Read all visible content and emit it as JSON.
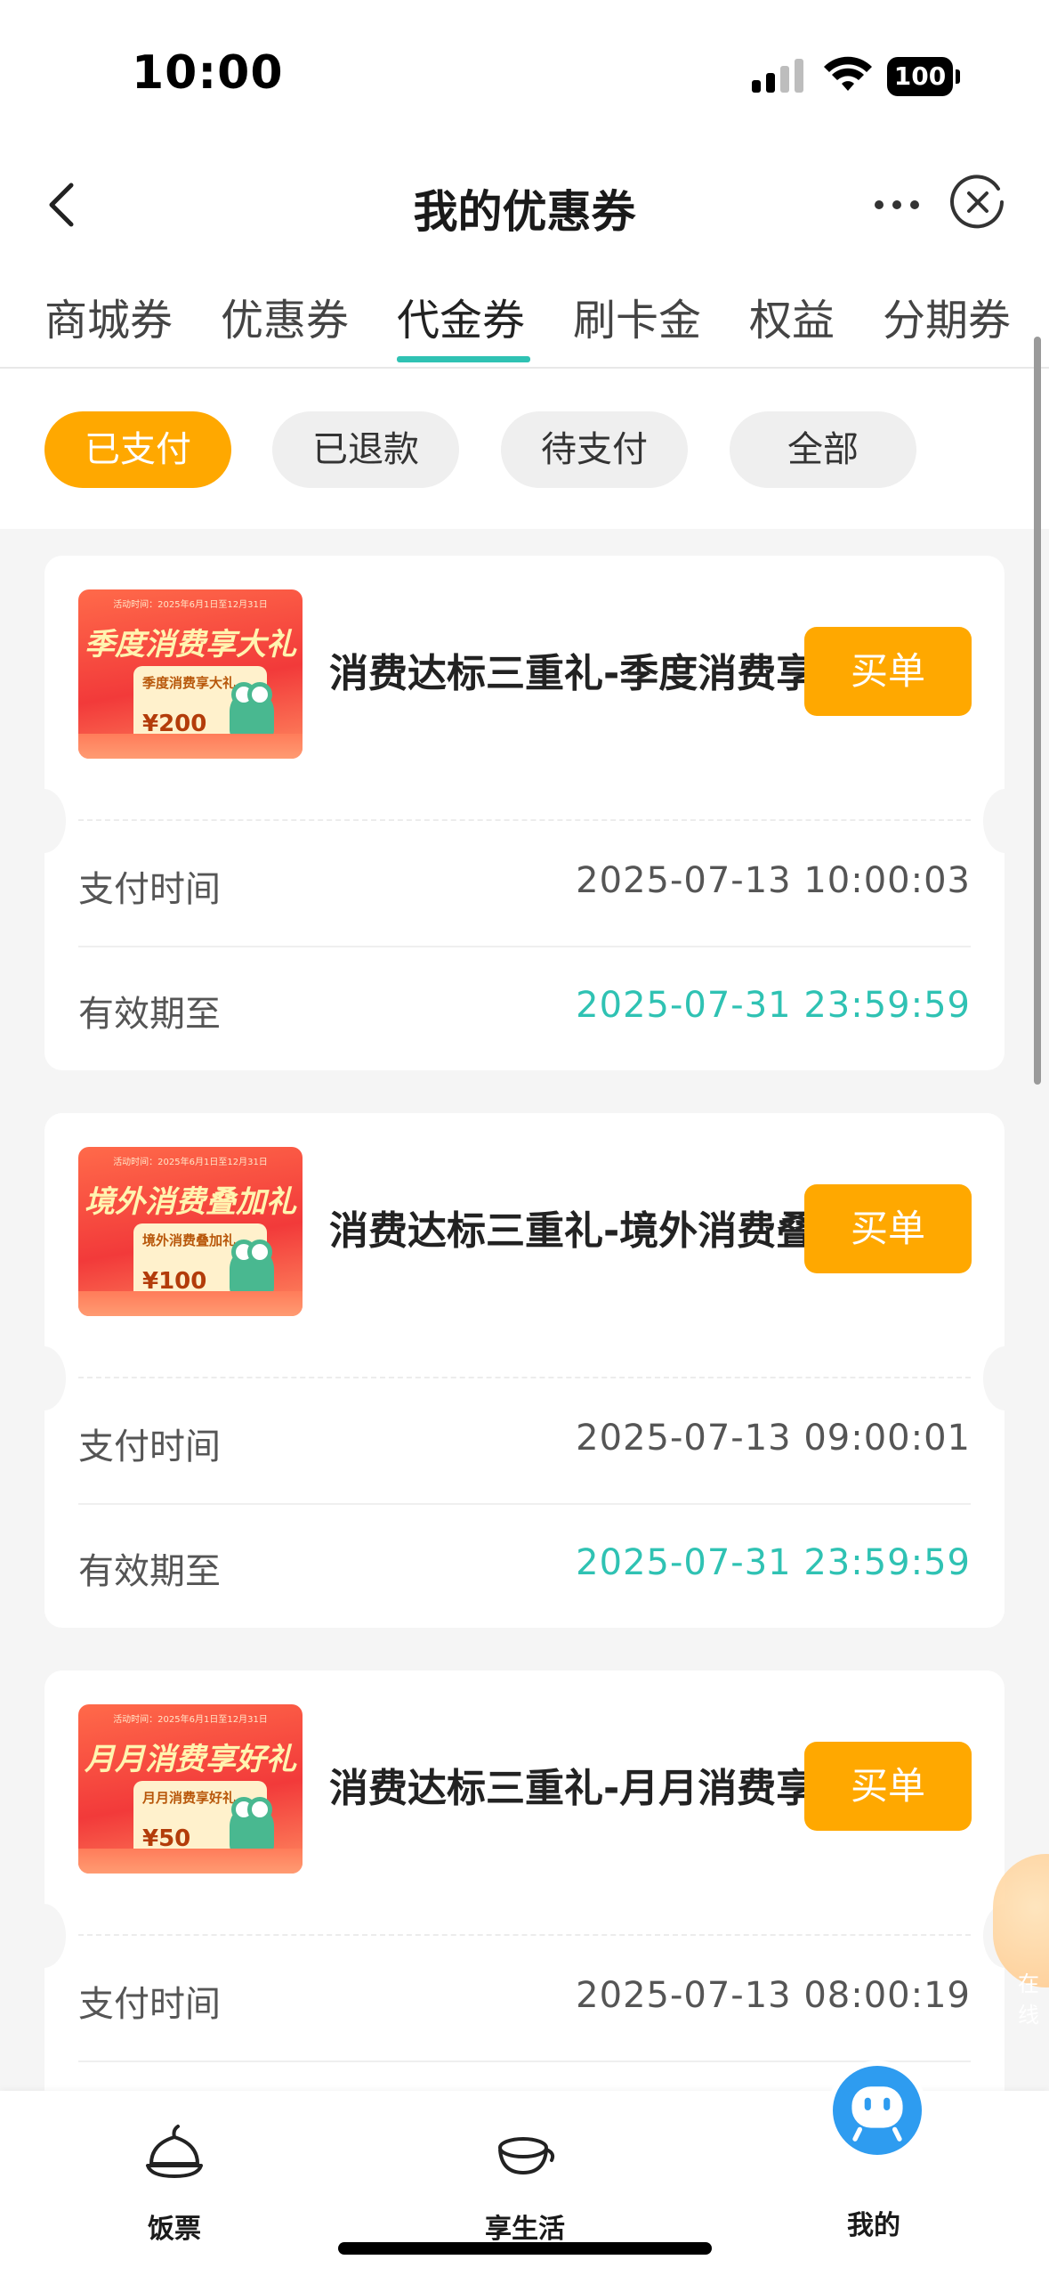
{
  "status_bar": {
    "time": "10:00",
    "battery": "100"
  },
  "nav": {
    "title": "我的优惠券"
  },
  "tabs": [
    "商城券",
    "优惠券",
    "代金券",
    "刷卡金",
    "权益",
    "分期券"
  ],
  "active_tab": "代金券",
  "filters": [
    "已支付",
    "已退款",
    "待支付",
    "全部"
  ],
  "active_filter": "已支付",
  "labels": {
    "pay_time": "支付时间",
    "valid_until": "有效期至",
    "buy": "买单"
  },
  "coupons": [
    {
      "title": "消费达标三重礼-季度消费享大礼",
      "pay_time": "2025-07-13 10:00:03",
      "valid_until": "2025-07-31 23:59:59",
      "thumb": {
        "headline": "季度消费享大礼",
        "panel_title": "季度消费享大礼",
        "amount": "¥200",
        "top_text": "活动时间：2025年6月1日至12月31日"
      }
    },
    {
      "title": "消费达标三重礼-境外消费叠加礼",
      "pay_time": "2025-07-13 09:00:01",
      "valid_until": "2025-07-31 23:59:59",
      "thumb": {
        "headline": "境外消费叠加礼",
        "panel_title": "境外消费叠加礼",
        "amount": "¥100",
        "top_text": "活动时间：2025年6月1日至12月31日"
      }
    },
    {
      "title": "消费达标三重礼-月月消费享好礼",
      "pay_time": "2025-07-13 08:00:19",
      "valid_until": "",
      "thumb": {
        "headline": "月月消费享好礼",
        "panel_title": "月月消费享好礼",
        "amount": "¥50",
        "top_text": "活动时间：2025年6月1日至12月31日"
      }
    }
  ],
  "bottom_nav": [
    {
      "label": "饭票",
      "icon": "rice-bowl-icon"
    },
    {
      "label": "享生活",
      "icon": "bowl-icon"
    },
    {
      "label": "我的",
      "icon": "avatar-icon"
    }
  ],
  "floating": {
    "text": "在线"
  },
  "colors": {
    "accent": "#ffa800",
    "teal": "#2fc2b3"
  }
}
